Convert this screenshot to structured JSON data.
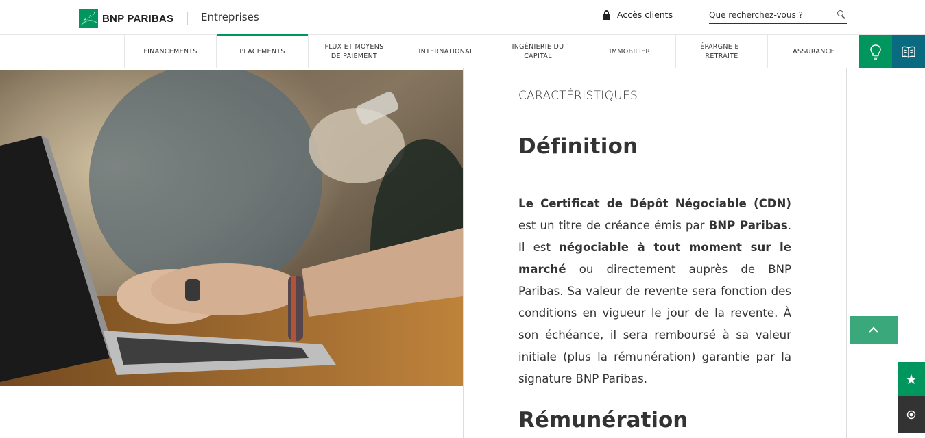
{
  "header": {
    "brand": "BNP PARIBAS",
    "site": "Entreprises",
    "access_label": "Accès clients",
    "search_placeholder": "Que recherchez-vous ?"
  },
  "nav": {
    "items": [
      {
        "label": "FINANCEMENTS"
      },
      {
        "label": "PLACEMENTS"
      },
      {
        "label": "FLUX ET MOYENS\nDE PAIEMENT"
      },
      {
        "label": "INTERNATIONAL"
      },
      {
        "label": "INGÉNIERIE DU\nCAPITAL"
      },
      {
        "label": "IMMOBILIER"
      },
      {
        "label": "ÉPARGNE ET\nRETRAITE"
      },
      {
        "label": "ASSURANCE"
      }
    ],
    "active": "PLACEMENTS",
    "icon_buttons": [
      "lightbulb-icon",
      "book-icon"
    ]
  },
  "content": {
    "kicker": "CARACTÉRISTIQUES",
    "heading": "Définition",
    "paragraph": {
      "s1": "Le Certificat de Dépôt Négociable (CDN)",
      "s2": " est un titre de créance émis par ",
      "s3": "BNP Paribas",
      "s4": ". Il est ",
      "s5": "négociable à tout moment sur le marché",
      "s6": " ou directement auprès de BNP Paribas. Sa valeur de revente sera fonction des conditions en vigueur le jour de la revente. À son échéance, il sera remboursé à sa valeur initiale (plus la rémunération) garantie par la signature BNP Paribas."
    },
    "heading2": "Rémunération"
  },
  "floating": {
    "star": "★"
  },
  "colors": {
    "brand_green": "#00965e",
    "teal": "#0a6a80",
    "back_to_top": "#3aa87a"
  }
}
